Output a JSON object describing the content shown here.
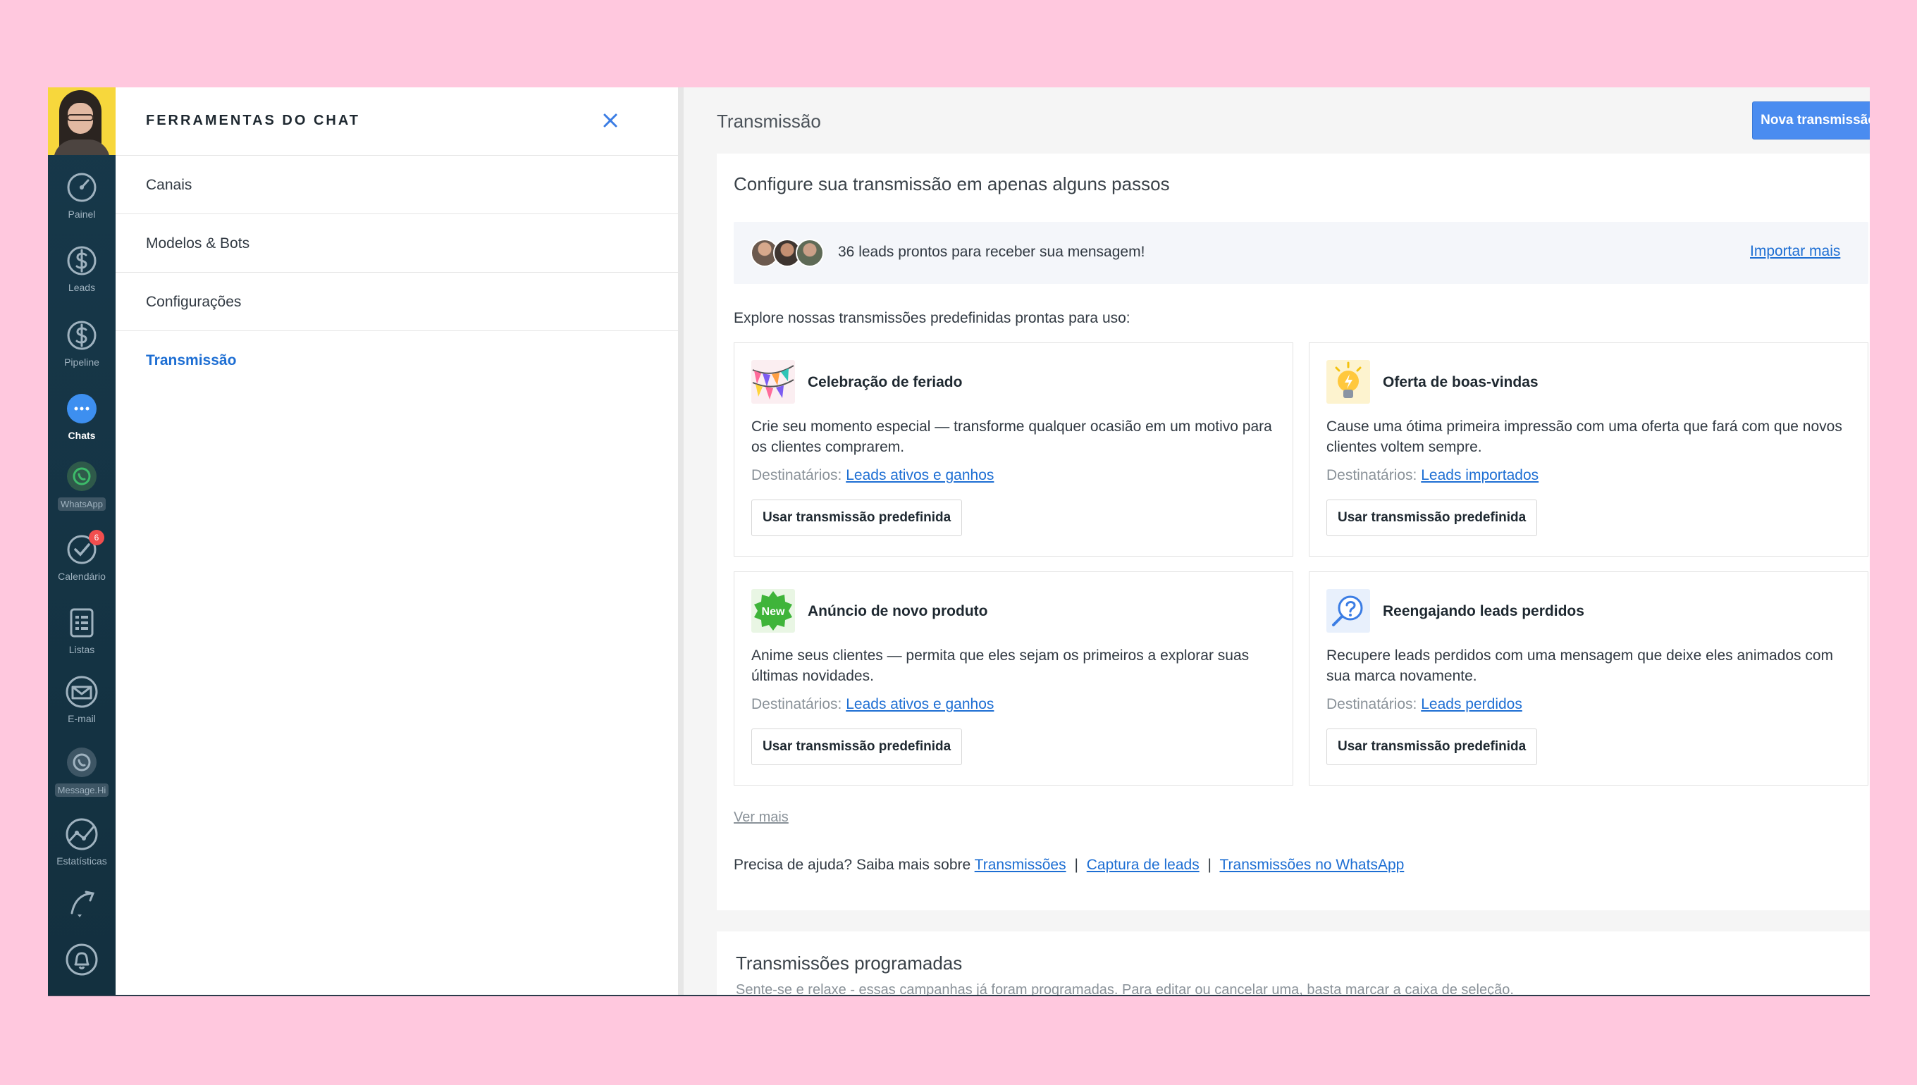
{
  "nav": {
    "items": [
      {
        "label": "Painel",
        "icon": "speedometer-icon"
      },
      {
        "label": "Leads",
        "icon": "dollar-icon"
      },
      {
        "label": "Pipeline",
        "icon": "dollar-icon"
      },
      {
        "label": "Chats",
        "icon": "chat-bubble-icon"
      },
      {
        "label": "WhatsApp",
        "icon": "whatsapp-icon"
      },
      {
        "label": "Calendário",
        "icon": "check-circle-icon",
        "badge": "6"
      },
      {
        "label": "Listas",
        "icon": "list-icon"
      },
      {
        "label": "E-mail",
        "icon": "envelope-icon"
      },
      {
        "label": "Message.Hi",
        "icon": "whatsapp-icon"
      },
      {
        "label": "Estatísticas",
        "icon": "chart-line-icon"
      },
      {
        "label": "",
        "icon": "wrench-icon"
      },
      {
        "label": "",
        "icon": "bell-icon"
      }
    ]
  },
  "tools": {
    "title": "FERRAMENTAS DO CHAT",
    "items": [
      "Canais",
      "Modelos & Bots",
      "Configurações",
      "Transmissão"
    ],
    "active": "Transmissão"
  },
  "main": {
    "title": "Transmissão",
    "new_button": "Nova transmissão",
    "card_title": "Configure sua transmissão em apenas alguns passos",
    "leads_text": "36 leads prontos para receber sua mensagem!",
    "import_link": "Importar mais",
    "explore_text": "Explore nossas transmissões predefinidas prontas para uso:",
    "templates": [
      {
        "title": "Celebração de feriado",
        "desc": "Crie seu momento especial — transforme qualquer ocasião em um motivo para os clientes comprarem.",
        "dest_label": "Destinatários:",
        "dest_link": "Leads ativos e ganhos",
        "button": "Usar transmissão predefinida",
        "icon": "party-flags-icon"
      },
      {
        "title": "Oferta de boas-vindas",
        "desc": "Cause uma ótima primeira impressão com uma oferta que fará com que novos clientes voltem sempre.",
        "dest_label": "Destinatários:",
        "dest_link": "Leads importados",
        "button": "Usar transmissão predefinida",
        "icon": "lightbulb-icon"
      },
      {
        "title": "Anúncio de novo produto",
        "desc": "Anime seus clientes — permita que eles sejam os primeiros a explorar suas últimas novidades.",
        "dest_label": "Destinatários:",
        "dest_link": "Leads ativos e ganhos",
        "button": "Usar transmissão predefinida",
        "icon": "new-badge-icon",
        "badge_text": "New"
      },
      {
        "title": "Reengajando leads perdidos",
        "desc": "Recupere leads perdidos com uma mensagem que deixe eles animados com sua marca novamente.",
        "dest_label": "Destinatários:",
        "dest_link": "Leads perdidos",
        "button": "Usar transmissão predefinida",
        "icon": "question-magnifier-icon"
      }
    ],
    "ver_mais": "Ver mais",
    "help_prefix": "Precisa de ajuda? Saiba mais sobre",
    "help_links": [
      "Transmissões",
      "Captura de leads",
      "Transmissões no WhatsApp"
    ],
    "help_sep": "|",
    "scheduled_title": "Transmissões programadas",
    "scheduled_sub": "Sente-se e relaxe - essas campanhas já foram programadas. Para editar ou cancelar uma, basta marcar a caixa de seleção."
  },
  "colors": {
    "accent": "#4a8cf0",
    "link": "#1d6ed3",
    "nav_bg": "#17384a",
    "page_bg": "#ffc8de",
    "badge": "#f24e4e"
  }
}
